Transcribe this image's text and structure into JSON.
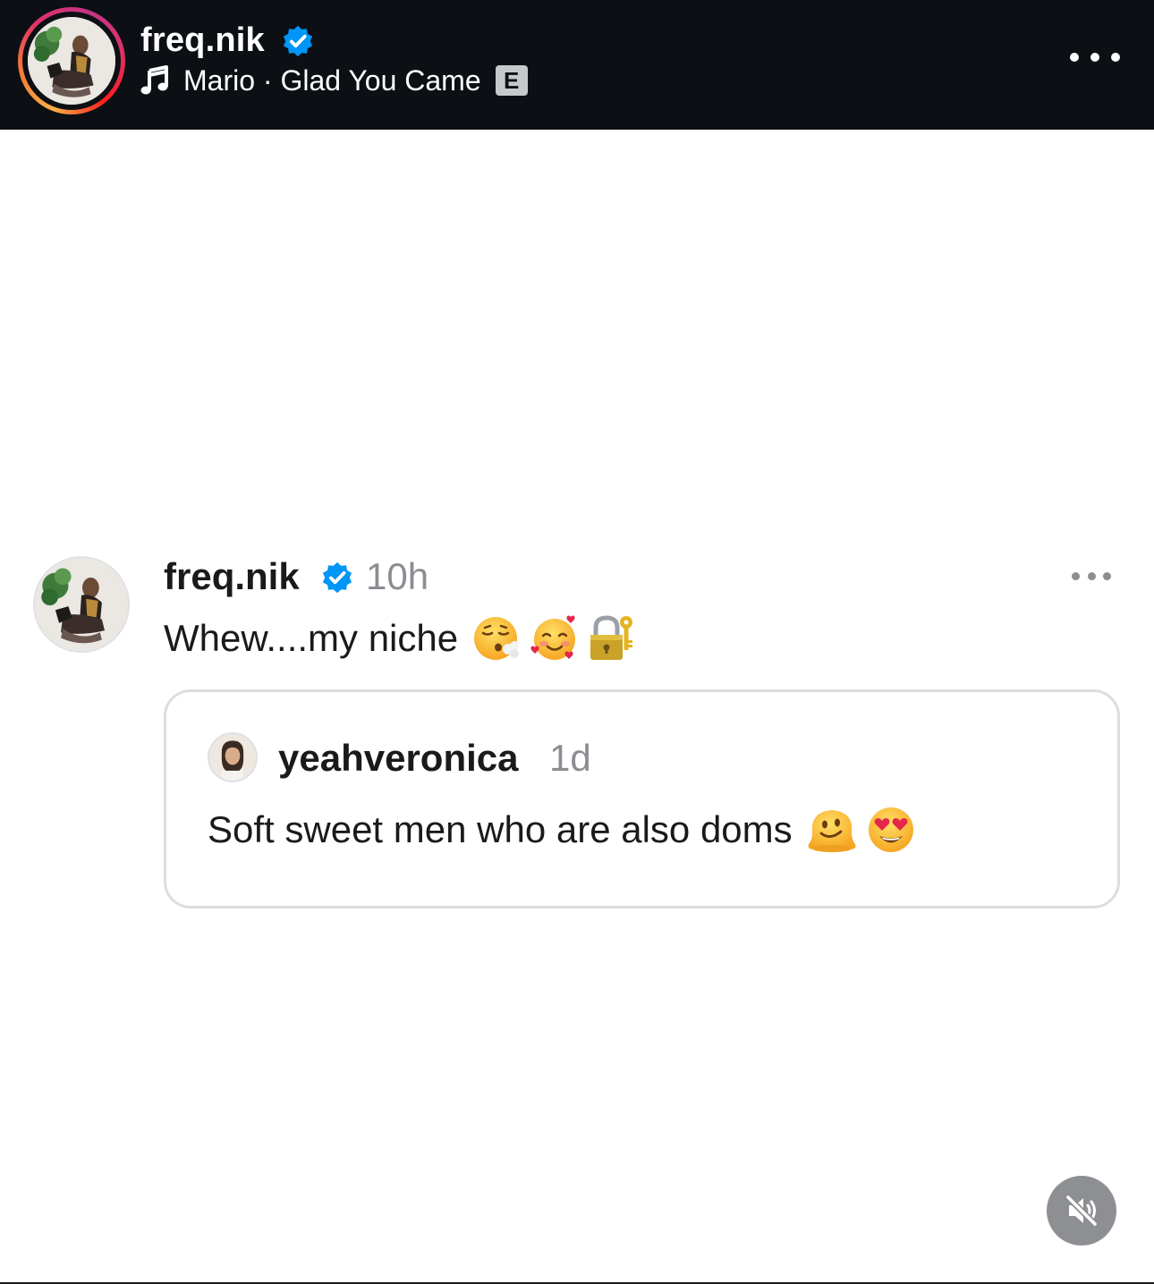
{
  "header": {
    "username": "freq.nik",
    "music": "Mario · Glad You Came",
    "explicit_badge": "E",
    "icons": [
      "music-note-icon",
      "verified-badge-icon",
      "more-options-icon"
    ]
  },
  "post": {
    "username": "freq.nik",
    "time": "10h",
    "text": "Whew....my niche",
    "emojis": [
      "face-exhaling-emoji",
      "smiling-face-with-hearts-emoji",
      "locked-with-key-emoji"
    ]
  },
  "quoted_post": {
    "username": "yeahveronica",
    "time": "1d",
    "text": "Soft sweet men who are also doms",
    "emojis": [
      "melting-face-emoji",
      "heart-eyes-emoji"
    ]
  },
  "controls": {
    "mute_icon": "speaker-muted-icon"
  },
  "colors": {
    "header_bg": "#0c1014",
    "verified_blue": "#0095f6",
    "secondary_text": "#8a8d91",
    "card_border": "#dbdde0",
    "mute_button_bg": "#8d8f92"
  }
}
